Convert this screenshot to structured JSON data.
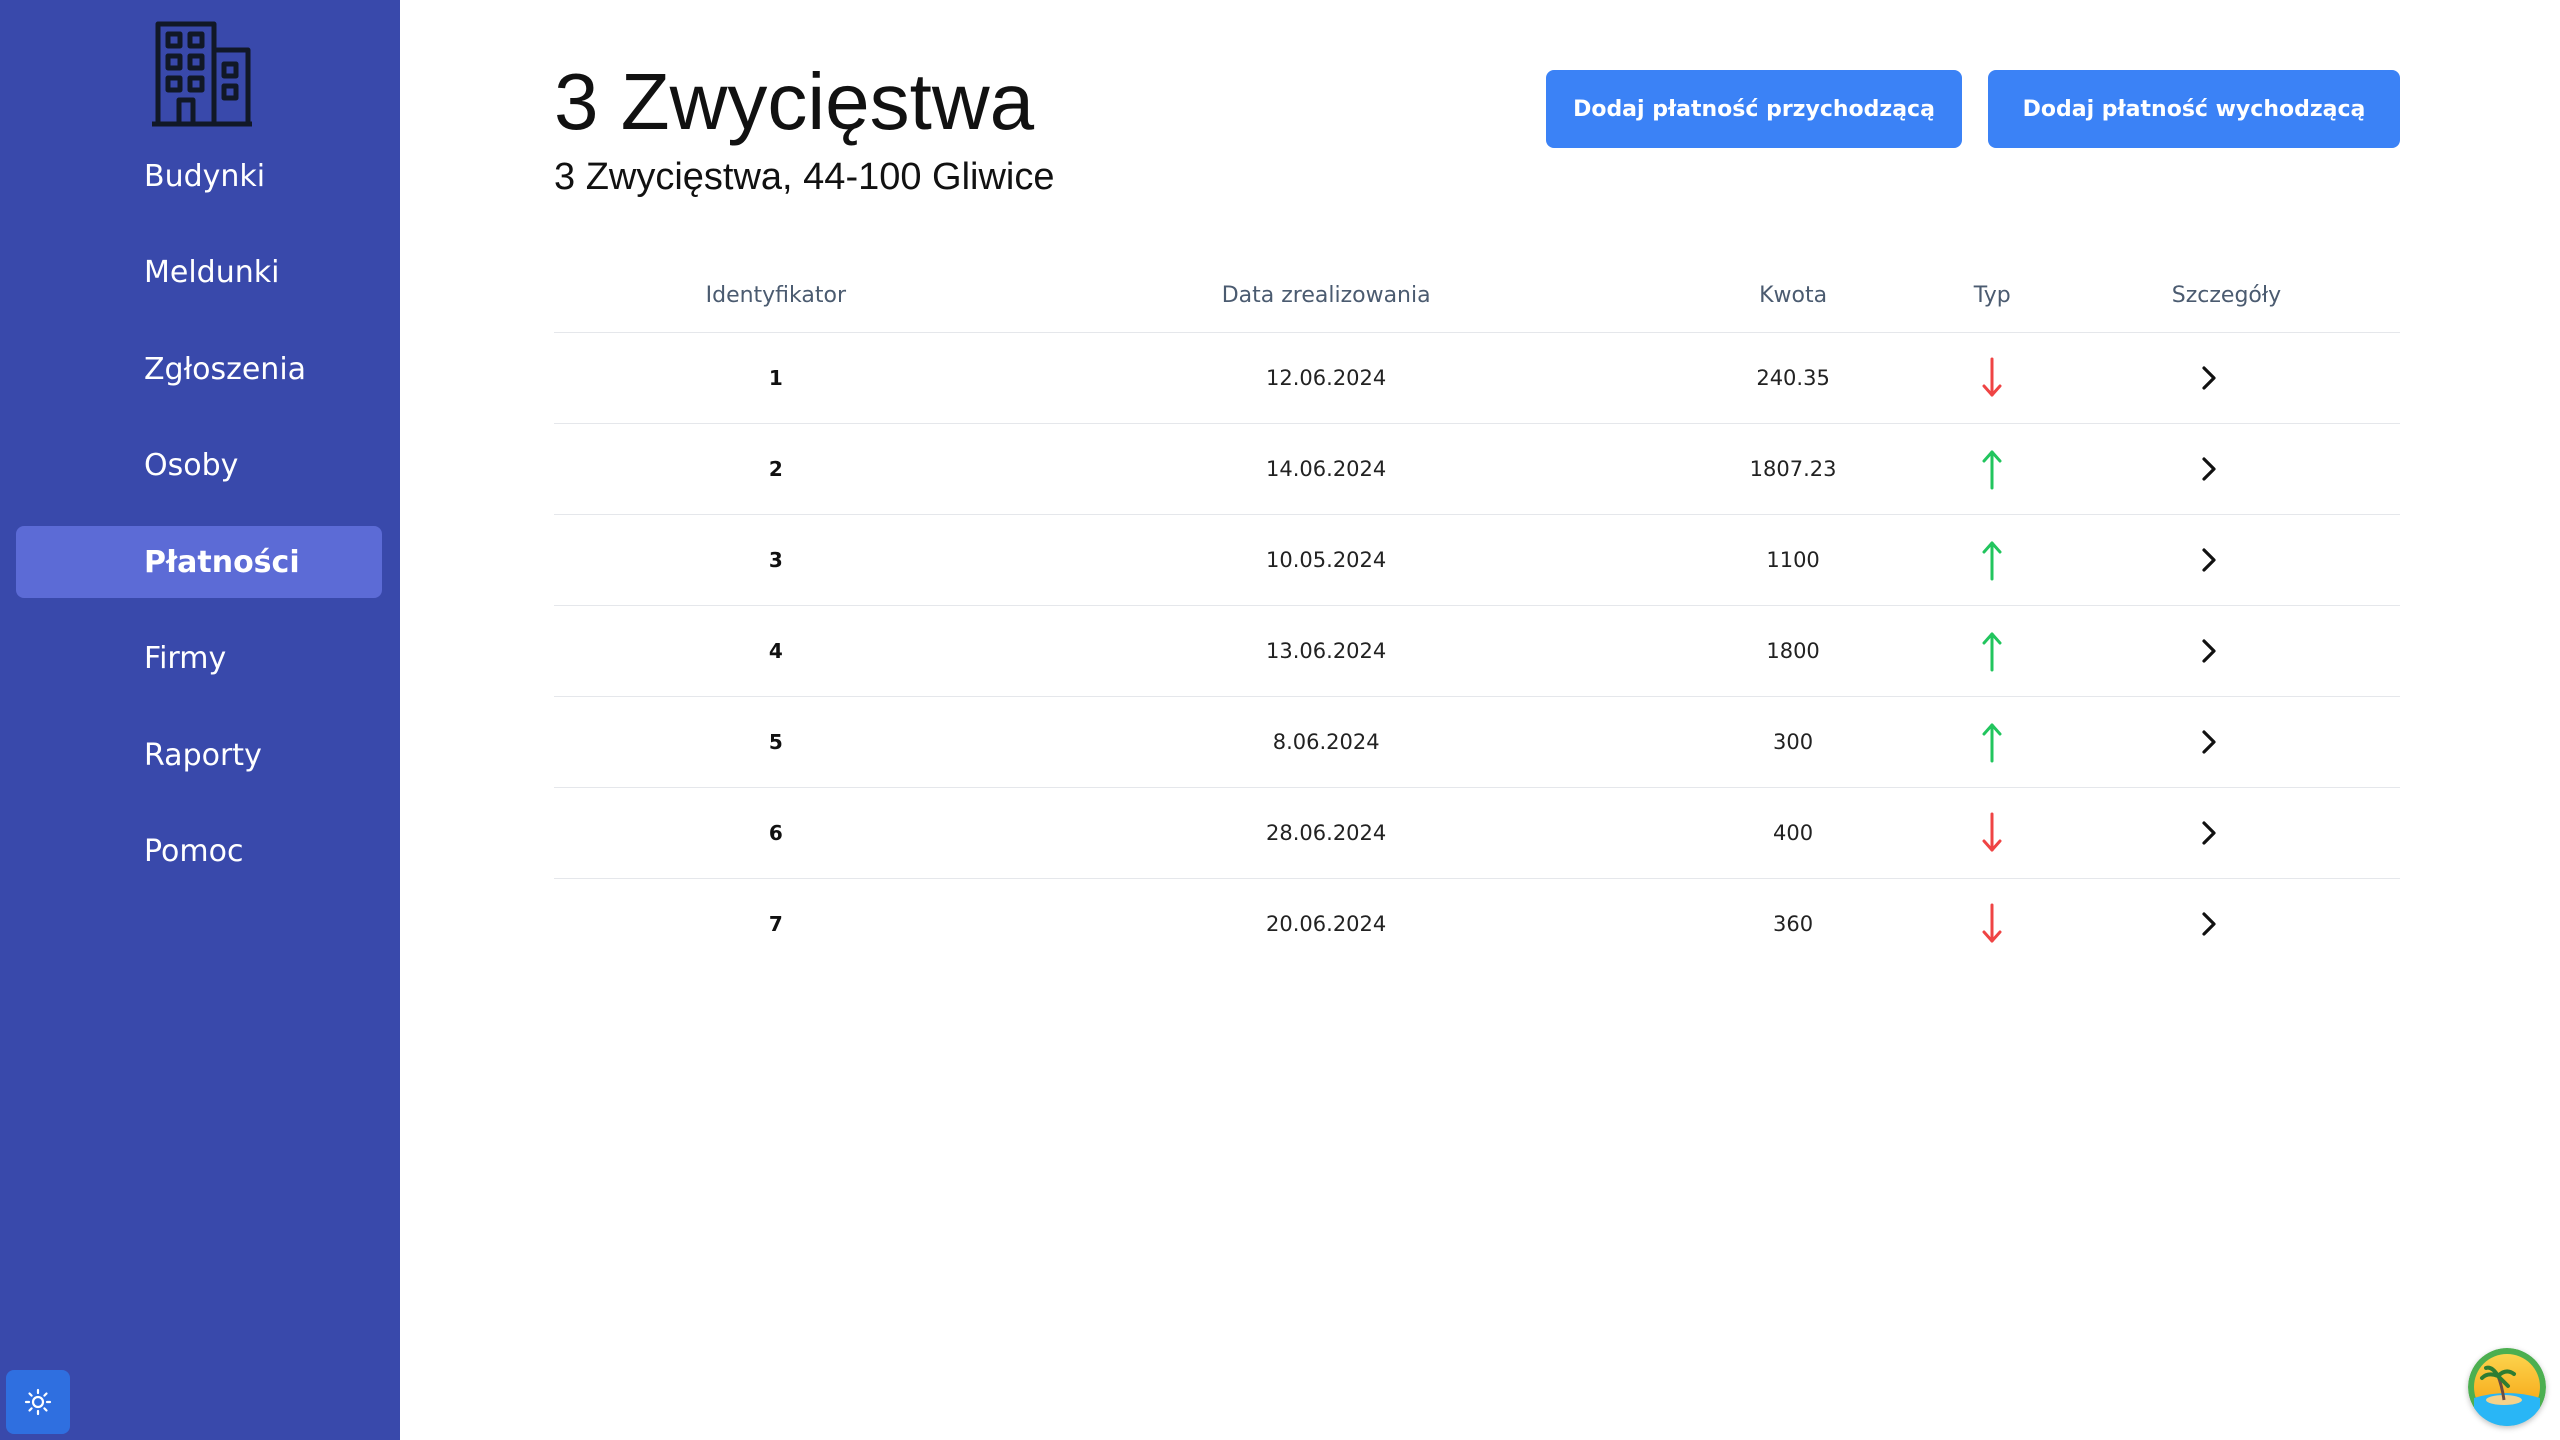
{
  "sidebar": {
    "items": [
      {
        "label": "Budynki",
        "active": false
      },
      {
        "label": "Meldunki",
        "active": false
      },
      {
        "label": "Zgłoszenia",
        "active": false
      },
      {
        "label": "Osoby",
        "active": false
      },
      {
        "label": "Płatności",
        "active": true
      },
      {
        "label": "Firmy",
        "active": false
      },
      {
        "label": "Raporty",
        "active": false
      },
      {
        "label": "Pomoc",
        "active": false
      }
    ],
    "logo_icon": "building-icon",
    "theme_icon": "sun-icon"
  },
  "header": {
    "title": "3 Zwycięstwa",
    "subtitle": "3 Zwycięstwa, 44-100 Gliwice",
    "add_incoming_label": "Dodaj płatność przychodzącą",
    "add_outgoing_label": "Dodaj płatność wychodzącą"
  },
  "table": {
    "columns": [
      "Identyfikator",
      "Data zrealizowania",
      "Kwota",
      "Typ",
      "Szczegóły"
    ],
    "rows": [
      {
        "id": "1",
        "date": "12.06.2024",
        "amount": "240.35",
        "type": "down"
      },
      {
        "id": "2",
        "date": "14.06.2024",
        "amount": "1807.23",
        "type": "up"
      },
      {
        "id": "3",
        "date": "10.05.2024",
        "amount": "1100",
        "type": "up"
      },
      {
        "id": "4",
        "date": "13.06.2024",
        "amount": "1800",
        "type": "up"
      },
      {
        "id": "5",
        "date": "8.06.2024",
        "amount": "300",
        "type": "up"
      },
      {
        "id": "6",
        "date": "28.06.2024",
        "amount": "400",
        "type": "down"
      },
      {
        "id": "7",
        "date": "20.06.2024",
        "amount": "360",
        "type": "down"
      }
    ]
  },
  "colors": {
    "sidebar_bg": "#3949ab",
    "sidebar_active": "#5c6bd6",
    "button_bg": "#3b82f6",
    "arrow_up": "#22c55e",
    "arrow_down": "#ef4444"
  }
}
